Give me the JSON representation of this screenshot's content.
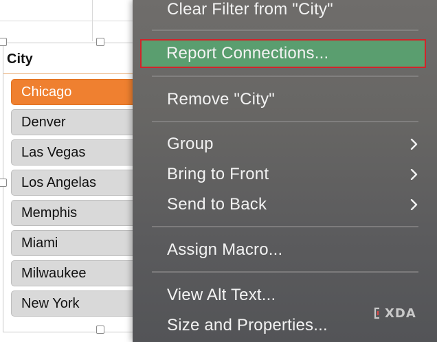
{
  "slicer": {
    "title": "City",
    "items": [
      {
        "label": "Chicago",
        "selected": true
      },
      {
        "label": "Denver",
        "selected": false
      },
      {
        "label": "Las Vegas",
        "selected": false
      },
      {
        "label": "Los Angelas",
        "selected": false
      },
      {
        "label": "Memphis",
        "selected": false
      },
      {
        "label": "Miami",
        "selected": false
      },
      {
        "label": "Milwaukee",
        "selected": false
      },
      {
        "label": "New York",
        "selected": false
      }
    ]
  },
  "menu": {
    "items": {
      "clear_filter": "Clear Filter from \"City\"",
      "report_connections": "Report Connections...",
      "remove": "Remove \"City\"",
      "group": "Group",
      "bring_to_front": "Bring to Front",
      "send_to_back": "Send to Back",
      "assign_macro": "Assign Macro...",
      "view_alt_text": "View Alt Text...",
      "size_properties": "Size and Properties..."
    }
  },
  "watermark": {
    "text": "XDA"
  },
  "colors": {
    "slicer_selected": "#ef8030",
    "menu_highlight": "#5a9e6f",
    "highlight_outline": "#d3232a"
  },
  "icons": {
    "submenu": "chevron-right-icon",
    "watermark_logo": "xda-logo-icon"
  }
}
